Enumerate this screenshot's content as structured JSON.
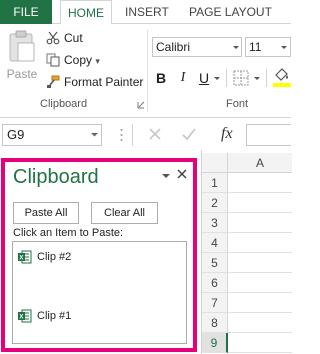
{
  "tabs": {
    "file": "FILE",
    "home": "HOME",
    "insert": "INSERT",
    "page_layout": "PAGE LAYOUT"
  },
  "ribbon": {
    "paste_label": "Paste",
    "cut_label": "Cut",
    "copy_label": "Copy",
    "copy_dropdown": "▾",
    "format_painter_label": "Format Painter",
    "clipboard_group_label": "Clipboard",
    "font_group_label": "Font",
    "font_name": "Calibri",
    "font_size": "11",
    "bold": "B",
    "italic": "I",
    "underline": "U"
  },
  "formula_bar": {
    "name_box": "G9",
    "fx": "fx"
  },
  "clipboard_pane": {
    "title": "Clipboard",
    "paste_all": "Paste All",
    "clear_all": "Clear All",
    "instruction": "Click an Item to Paste:",
    "items": [
      {
        "label": "Clip #2",
        "icon": "excel-icon"
      },
      {
        "label": "Clip #1",
        "icon": "excel-icon"
      }
    ]
  },
  "grid": {
    "column": "A",
    "rows": [
      "1",
      "2",
      "3",
      "4",
      "5",
      "6",
      "7",
      "8",
      "9"
    ],
    "active_row": "9"
  },
  "colors": {
    "accent": "#217346",
    "highlight": "#e6007e"
  }
}
